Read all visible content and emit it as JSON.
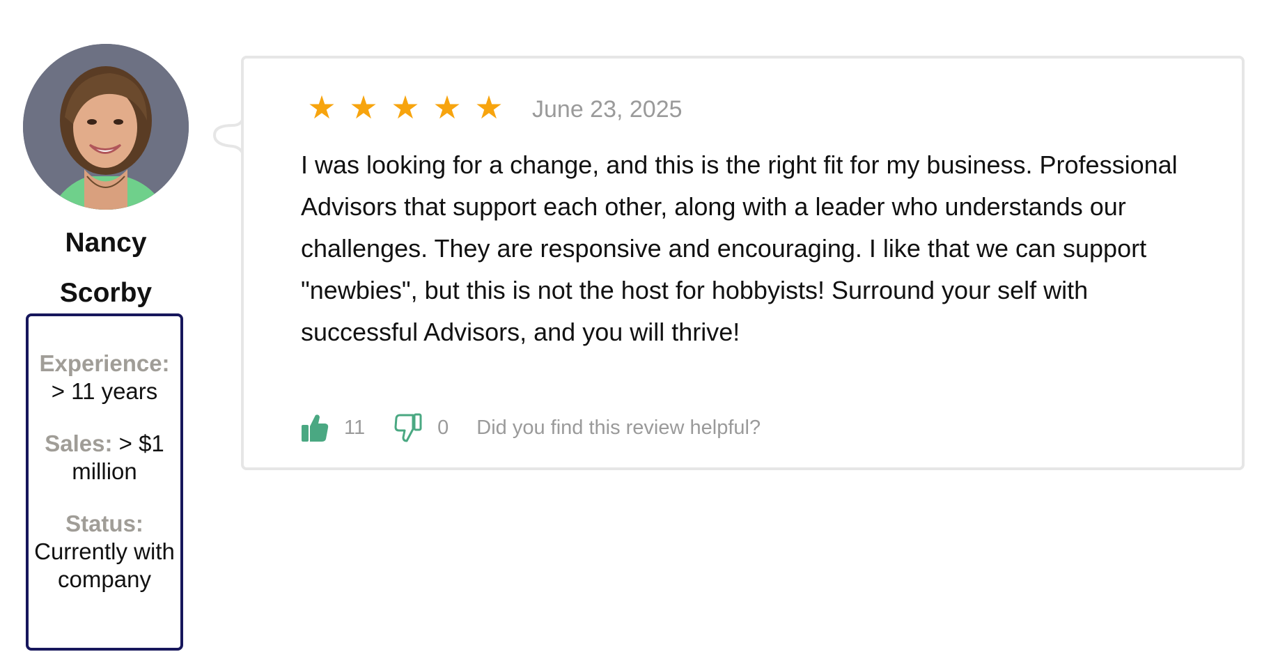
{
  "reviewer": {
    "first_name": "Nancy",
    "last_name": "Scorby",
    "stats": [
      {
        "label": "Experience:",
        "value": "> 11 years"
      },
      {
        "label": "Sales:",
        "value": "> $1 million"
      },
      {
        "label": "Status:",
        "value": "Currently with company"
      }
    ]
  },
  "review": {
    "rating": 5,
    "stars": [
      "★",
      "★",
      "★",
      "★",
      "★"
    ],
    "date": "June 23, 2025",
    "text": "I was looking for a change, and this is the right fit for my business. Professional Advisors that support each other, along with a leader who understands our challenges. They are responsive and encouraging. I like that we can support \"newbies\", but this is not the host for hobbyists! Surround your self with successful Advisors, and you will thrive!",
    "helpful_up_count": "11",
    "helpful_down_count": "0",
    "helpful_question": "Did you find this review helpful?"
  },
  "icons": {
    "thumbs_up": "thumbs-up-icon",
    "thumbs_down": "thumbs-down-icon",
    "star": "star-icon"
  },
  "colors": {
    "star": "#f7a40e",
    "thumbs": "#4aa882",
    "stats_border": "#17175c",
    "muted_text": "#9a9a9a",
    "stat_label": "#a09d97"
  }
}
